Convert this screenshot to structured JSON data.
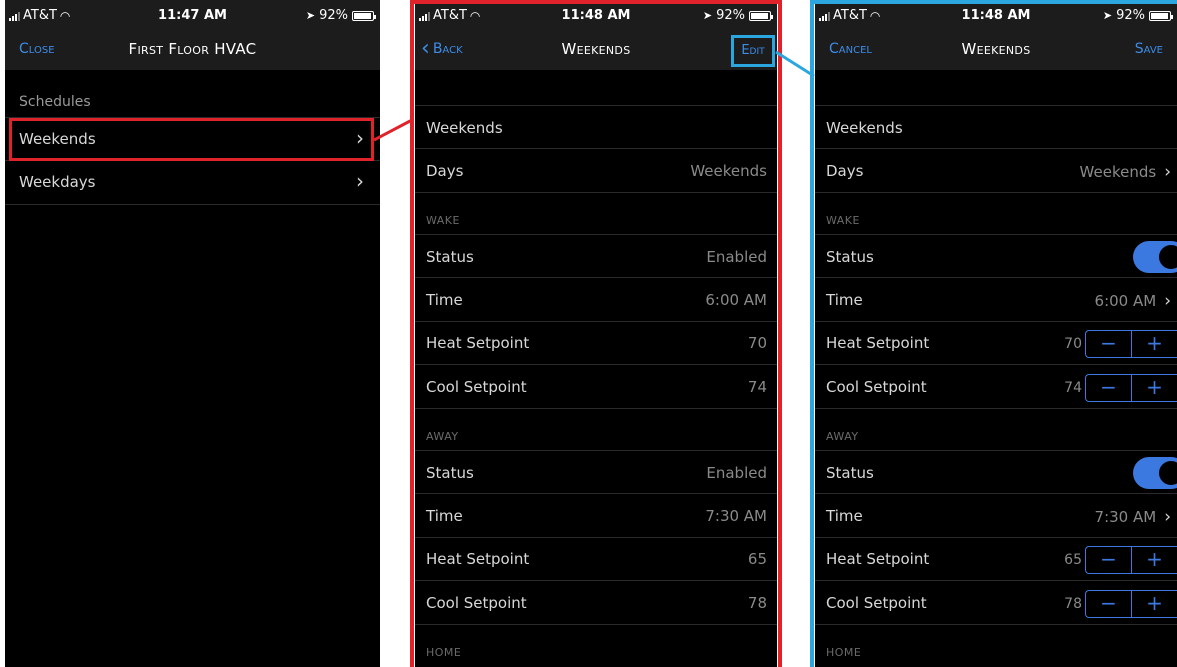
{
  "statusbar": {
    "p1": {
      "carrier": "AT&T",
      "time": "11:47 AM",
      "battery": "92%"
    },
    "p2": {
      "carrier": "AT&T",
      "time": "11:48 AM",
      "battery": "92%"
    },
    "p3": {
      "carrier": "AT&T",
      "time": "11:48 AM",
      "battery": "92%"
    }
  },
  "panel1": {
    "nav": {
      "left": "Close",
      "title": "First Floor HVAC"
    },
    "section": "Schedules",
    "items": [
      {
        "label": "Weekends"
      },
      {
        "label": "Weekdays"
      }
    ]
  },
  "panel2": {
    "nav": {
      "left": "Back",
      "title": "Weekends",
      "right": "Edit"
    },
    "name": "Weekends",
    "days": {
      "label": "Days",
      "value": "Weekends"
    },
    "wake": {
      "header": "WAKE",
      "status": {
        "label": "Status",
        "value": "Enabled"
      },
      "time": {
        "label": "Time",
        "value": "6:00 AM"
      },
      "heat": {
        "label": "Heat Setpoint",
        "value": "70"
      },
      "cool": {
        "label": "Cool Setpoint",
        "value": "74"
      }
    },
    "away": {
      "header": "AWAY",
      "status": {
        "label": "Status",
        "value": "Enabled"
      },
      "time": {
        "label": "Time",
        "value": "7:30 AM"
      },
      "heat": {
        "label": "Heat Setpoint",
        "value": "65"
      },
      "cool": {
        "label": "Cool Setpoint",
        "value": "78"
      }
    },
    "home": {
      "header": "HOME"
    }
  },
  "panel3": {
    "nav": {
      "left": "Cancel",
      "title": "Weekends",
      "right": "Save"
    },
    "name": "Weekends",
    "days": {
      "label": "Days",
      "value": "Weekends"
    },
    "wake": {
      "header": "WAKE",
      "status": {
        "label": "Status",
        "enabled": true
      },
      "time": {
        "label": "Time",
        "value": "6:00 AM"
      },
      "heat": {
        "label": "Heat Setpoint",
        "value": "70"
      },
      "cool": {
        "label": "Cool Setpoint",
        "value": "74"
      }
    },
    "away": {
      "header": "AWAY",
      "status": {
        "label": "Status",
        "enabled": true
      },
      "time": {
        "label": "Time",
        "value": "7:30 AM"
      },
      "heat": {
        "label": "Heat Setpoint",
        "value": "65"
      },
      "cool": {
        "label": "Cool Setpoint",
        "value": "78"
      }
    },
    "home": {
      "header": "HOME"
    },
    "stepper": {
      "minus": "−",
      "plus": "+"
    }
  },
  "colors": {
    "accent": "#3b78e0",
    "highlight_red": "#e0232b",
    "highlight_blue": "#2ba6de",
    "background": "#000000"
  }
}
